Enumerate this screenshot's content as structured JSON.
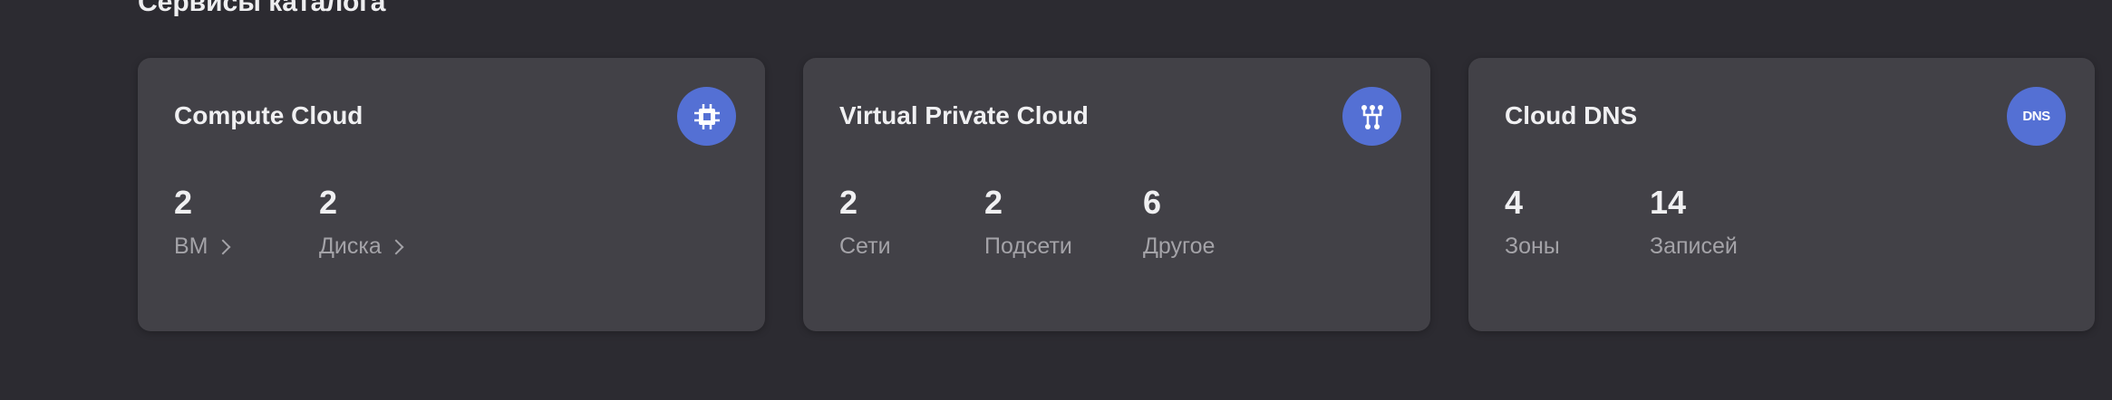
{
  "heading": "Сервисы каталога",
  "cards": [
    {
      "title": "Compute Cloud",
      "icon": "cpu-icon",
      "stats": [
        {
          "value": "2",
          "label": "ВМ",
          "link": true
        },
        {
          "value": "2",
          "label": "Диска",
          "link": true
        }
      ]
    },
    {
      "title": "Virtual Private Cloud",
      "icon": "network-icon",
      "stats": [
        {
          "value": "2",
          "label": "Сети"
        },
        {
          "value": "2",
          "label": "Подсети"
        },
        {
          "value": "6",
          "label": "Другое"
        }
      ]
    },
    {
      "title": "Cloud DNS",
      "icon": "dns-icon",
      "icon_text": "DNS",
      "stats": [
        {
          "value": "4",
          "label": "Зоны"
        },
        {
          "value": "14",
          "label": "Записей"
        }
      ]
    }
  ],
  "colors": {
    "background": "#2c2b31",
    "card": "#424147",
    "accent": "#5470d4"
  }
}
